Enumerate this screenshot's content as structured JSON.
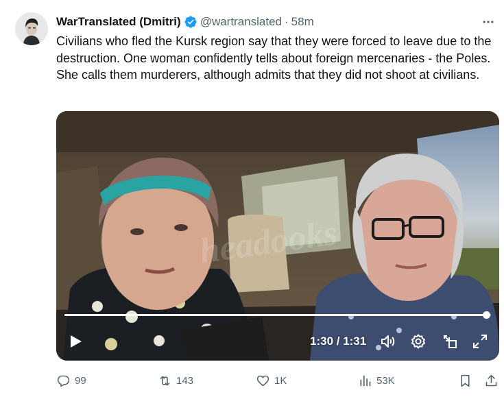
{
  "author": {
    "display_name": "WarTranslated (Dmitri)",
    "handle": "@wartranslated",
    "separator": "·",
    "time": "58m",
    "verified": true,
    "avatar_icon": "avatar-portrait"
  },
  "tweet": {
    "text": "Civilians who fled the Kursk region say that they were forced to leave due to the destruction. One woman confidently tells about foreign mercenaries - the Poles. She calls them murderers, although admits that they did not shoot at civilians."
  },
  "video": {
    "watermark": "headooks",
    "current_time": "1:30",
    "duration": "1:31",
    "time_display": "1:30 / 1:31",
    "progress": 0.989,
    "controls": [
      "play-icon",
      "volume-icon",
      "settings-icon",
      "pip-icon",
      "fullscreen-icon"
    ]
  },
  "actions": {
    "replies": "99",
    "reposts": "143",
    "likes": "1K",
    "views": "53K"
  },
  "colors": {
    "text": "#0f1419",
    "secondary": "#536471",
    "verified": "#1d9bf0"
  }
}
